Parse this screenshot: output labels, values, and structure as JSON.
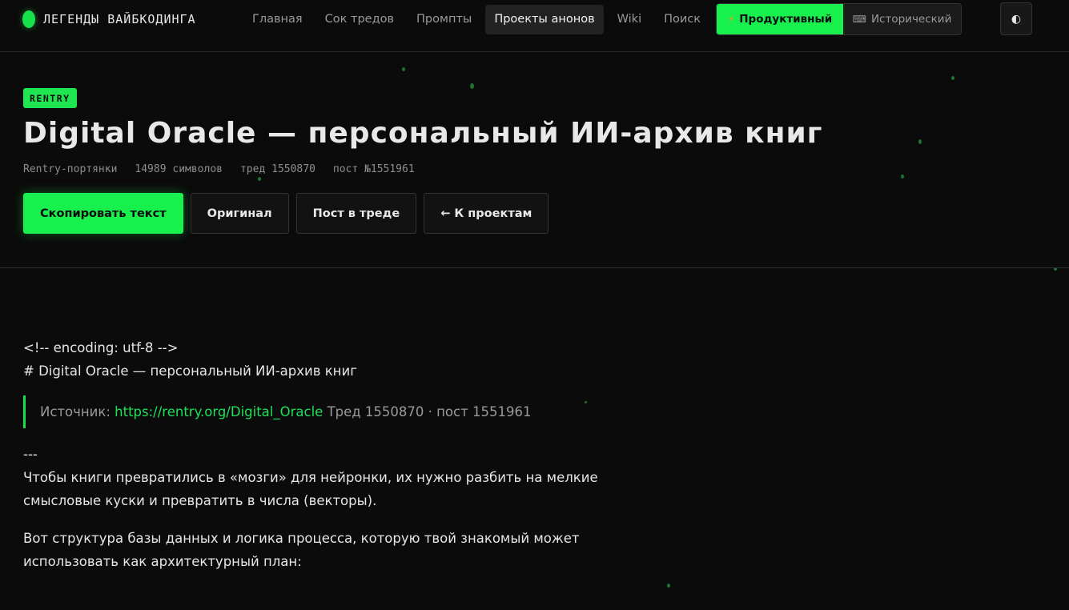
{
  "brand": {
    "name": "ЛЕГЕНДЫ ВАЙБКОДИНГА",
    "icon": "leaf-icon"
  },
  "nav": {
    "items": [
      {
        "label": "Главная",
        "active": false
      },
      {
        "label": "Сок тредов",
        "active": false
      },
      {
        "label": "Промпты",
        "active": false
      },
      {
        "label": "Проекты анонов",
        "active": true
      },
      {
        "label": "Wiki",
        "active": false
      },
      {
        "label": "Поиск",
        "active": false
      }
    ]
  },
  "mode": {
    "productive": {
      "label": "Продуктивный",
      "icon": "lightning-icon"
    },
    "historical": {
      "label": "Исторический",
      "icon": "typewriter-icon"
    }
  },
  "theme_toggle": {
    "icon": "half-circle-icon",
    "glyph": "◐"
  },
  "header": {
    "badge": "RENTRY",
    "title": "Digital Oracle — персональный ИИ-архив книг",
    "meta": [
      "Rentry-портянки",
      "14989 символов",
      "тред 1550870",
      "пост №1551961"
    ]
  },
  "actions": {
    "copy": "Скопировать текст",
    "original": "Оригинал",
    "thread_post": "Пост в треде",
    "back": "← К проектам"
  },
  "content": {
    "line1": "<!-- encoding: utf-8 -->",
    "line2": "# Digital Oracle — персональный ИИ-архив книг",
    "quote": {
      "prefix": "Источник: ",
      "link": "https://rentry.org/Digital_Oracle",
      "suffix": " Тред 1550870 · пост 1551961"
    },
    "hr": "---",
    "para1": "Чтобы книги превратились в «мозги» для нейронки, их нужно разбить на мелкие смысловые куски и превратить в числа (векторы).",
    "para2": "Вот структура базы данных и логика процесса, которую твой знакомый может использовать как архитектурный план:"
  },
  "colors": {
    "accent": "#17f04d",
    "background": "#0b0b0b"
  }
}
